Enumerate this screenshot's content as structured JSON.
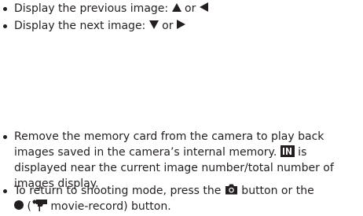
{
  "top_list": {
    "prev": {
      "text_before": "Display the previous image: ",
      "or": " or ",
      "icon_a": "up-triangle-icon",
      "icon_b": "left-triangle-icon"
    },
    "next": {
      "text_before": "Display the next image: ",
      "or": " or ",
      "icon_a": "down-triangle-icon",
      "icon_b": "right-triangle-icon"
    }
  },
  "bottom_list": {
    "memory": {
      "line1": "Remove the memory card from the camera to play back",
      "line2_before": "images saved in the camera’s internal memory. ",
      "line2_after": " is",
      "line3": "displayed near the current image number/total number of",
      "line4": "images display.",
      "icon": "internal-memory-icon"
    },
    "return": {
      "line1": "To return to shooting mode, press the ",
      "line1_after": " button or the",
      "line2_open": " (",
      "line2_after": " movie-record) button.",
      "icons": [
        "camera-icon",
        "record-dot-icon",
        "movie-camera-icon"
      ]
    }
  },
  "colors": {
    "text": "#231f20",
    "background": "#ffffff"
  }
}
